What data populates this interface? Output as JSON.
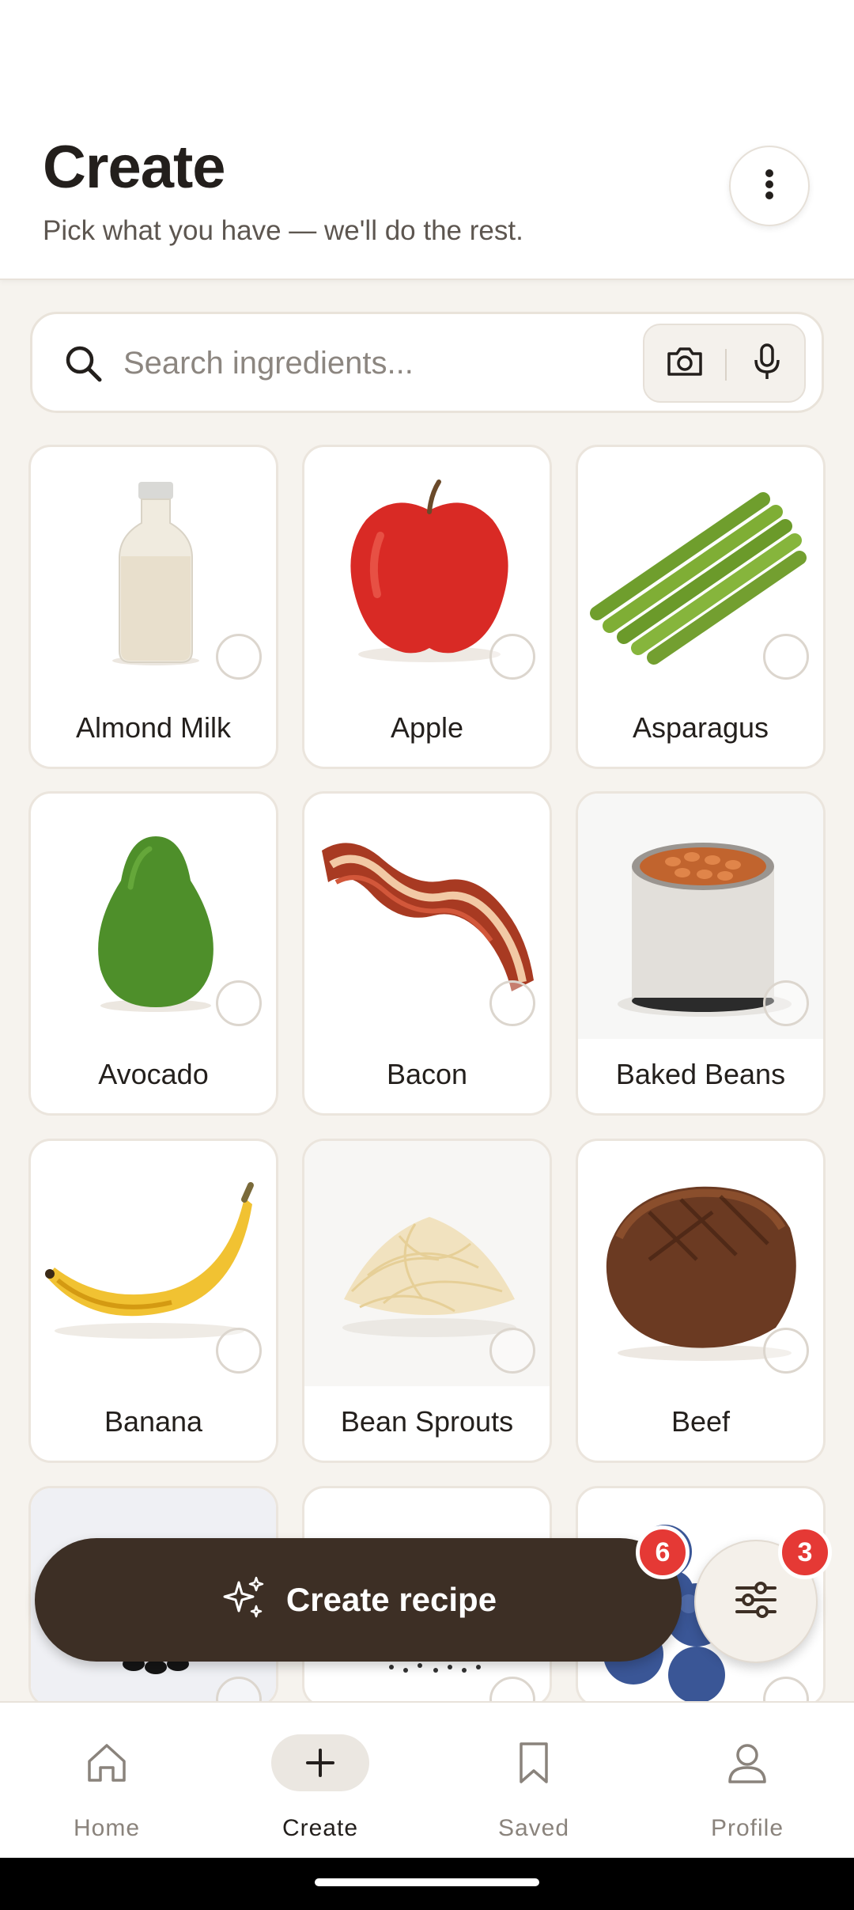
{
  "header": {
    "title": "Create",
    "subtitle": "Pick what you have — we'll do the rest."
  },
  "search": {
    "placeholder": "Search ingredients...",
    "value": ""
  },
  "ingredients": [
    {
      "label": "Almond Milk"
    },
    {
      "label": "Apple"
    },
    {
      "label": "Asparagus"
    },
    {
      "label": "Avocado"
    },
    {
      "label": "Bacon"
    },
    {
      "label": "Baked Beans"
    },
    {
      "label": "Banana"
    },
    {
      "label": "Bean Sprouts"
    },
    {
      "label": "Beef"
    }
  ],
  "cta": {
    "label": "Create recipe",
    "selected_count": "6"
  },
  "filter": {
    "count": "3"
  },
  "nav": {
    "items": [
      {
        "label": "Home"
      },
      {
        "label": "Create"
      },
      {
        "label": "Saved"
      },
      {
        "label": "Profile"
      }
    ],
    "active": "Create"
  },
  "colors": {
    "accent_dark": "#3d2f25",
    "badge": "#e53935",
    "background": "#f6f3ee"
  }
}
